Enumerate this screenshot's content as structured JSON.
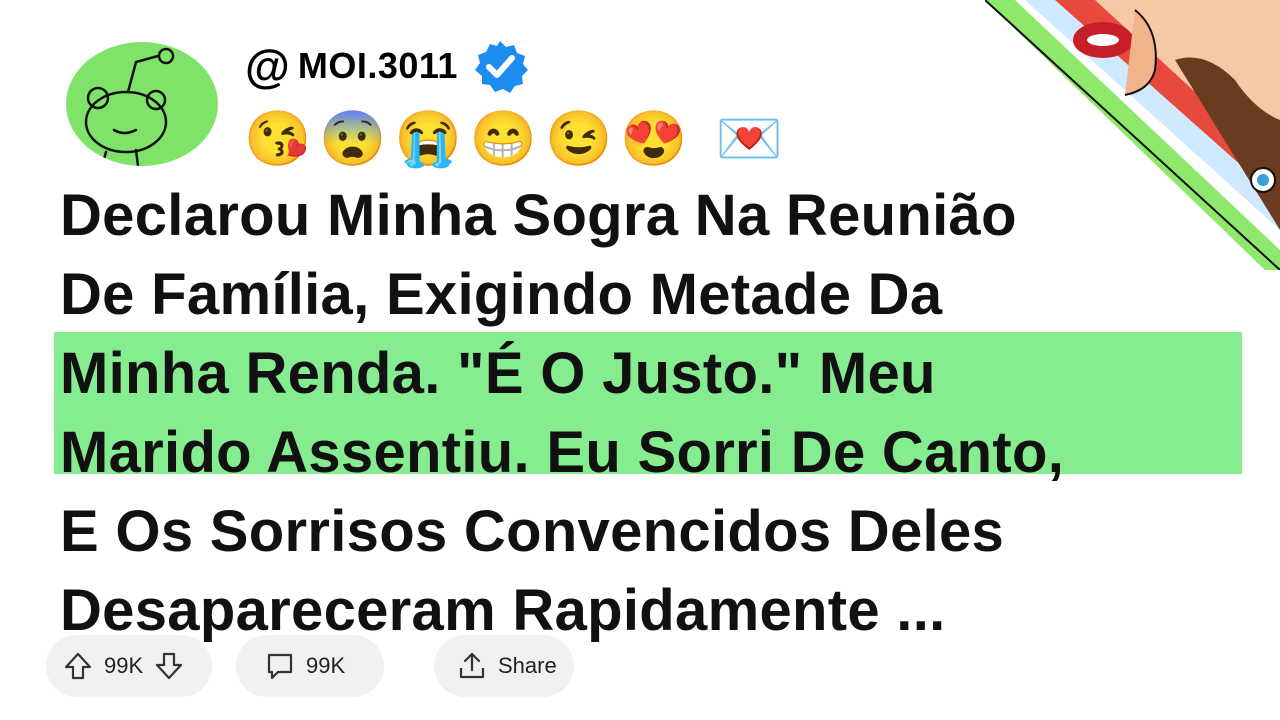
{
  "profile": {
    "at_symbol": "@",
    "username": "MOI.3011",
    "verified": true,
    "avatar_icon": "snoo-avatar-icon",
    "avatar_color": "#7fe36a",
    "verified_color": "#1d8cf0"
  },
  "emojis": [
    "😘",
    "😨",
    "😭",
    "😁",
    "😉",
    "😍",
    "💌"
  ],
  "post": {
    "title_lines": [
      "Declarou Minha Sogra Na Reunião",
      "De Família, Exigindo Metade Da",
      "Minha Renda. \"É O Justo.\" Meu",
      "Marido Assentiu. Eu Sorri De Canto,",
      "E Os Sorrisos Convencidos Deles",
      "Desapareceram Rapidamente ..."
    ],
    "highlight_color": "#86ec90"
  },
  "actions": {
    "votes": "99K",
    "comments": "99K",
    "share_label": "Share",
    "pill_color": "#f0f1f3"
  },
  "corner_image": {
    "description": "pop-art-woman-whispering-icon",
    "stripe_color": "#8ee86c"
  }
}
